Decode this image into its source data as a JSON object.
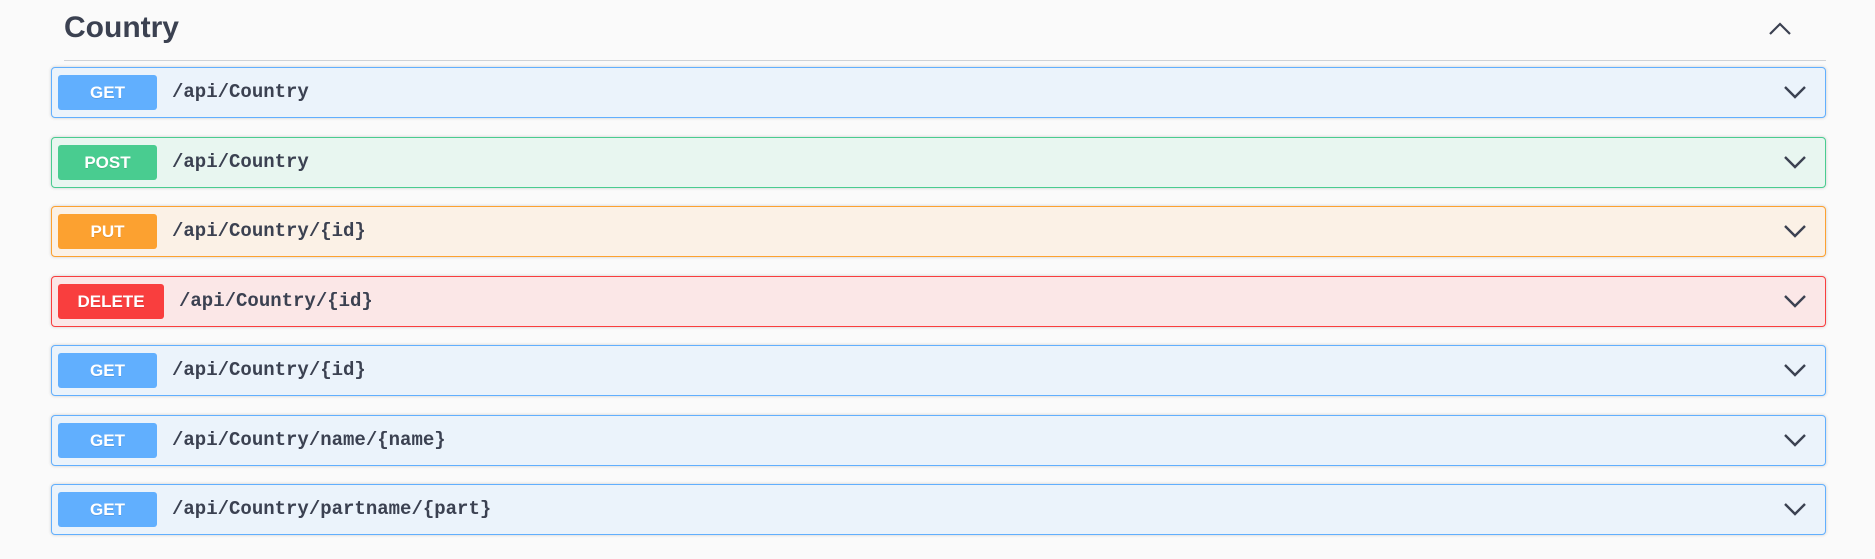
{
  "section": {
    "title": "Country",
    "toggle_icon": "chevron-up-icon"
  },
  "colors": {
    "get": "#61affe",
    "post": "#49cc90",
    "put": "#fca130",
    "delete": "#f93e3e",
    "title": "#3b4151"
  },
  "operations": [
    {
      "method": "GET",
      "path": "/api/Country"
    },
    {
      "method": "POST",
      "path": "/api/Country"
    },
    {
      "method": "PUT",
      "path": "/api/Country/{id}"
    },
    {
      "method": "DELETE",
      "path": "/api/Country/{id}"
    },
    {
      "method": "GET",
      "path": "/api/Country/{id}"
    },
    {
      "method": "GET",
      "path": "/api/Country/name/{name}"
    },
    {
      "method": "GET",
      "path": "/api/Country/partname/{part}"
    }
  ]
}
